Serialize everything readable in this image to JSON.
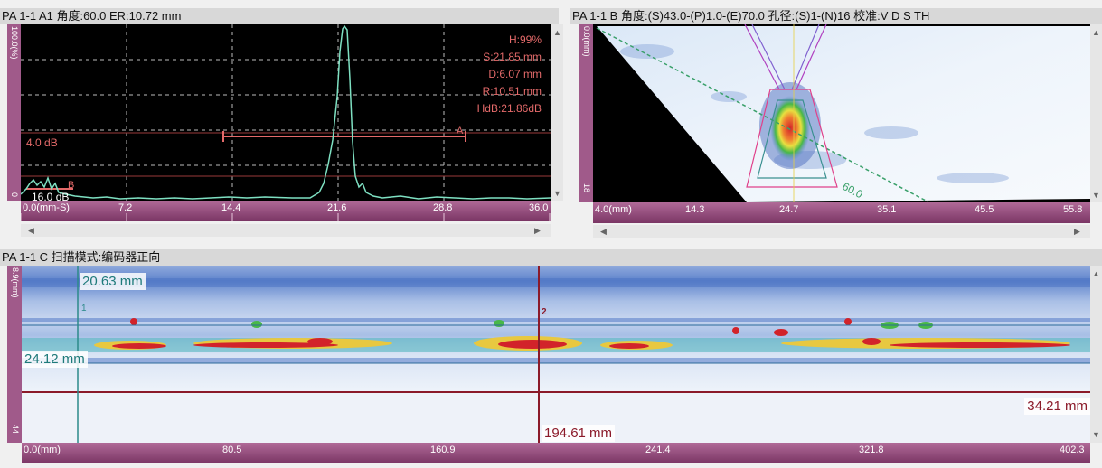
{
  "ascan": {
    "title": "PA 1-1 A1 角度:60.0 ER:10.72 mm",
    "vscale_label": "100.0(%)",
    "vscale_bottom": "0",
    "gate_label": "4.0 dB",
    "gate_marker": "A",
    "ref_label": "16.0 dB",
    "ref_marker": "B",
    "readouts": [
      "H:99%",
      "S:21.85 mm",
      "D:6.07 mm",
      "R:10.51 mm",
      "HdB:21.86dB"
    ],
    "axis_ticks": [
      "0.0(mm-S)",
      "7.2",
      "14.4",
      "21.6",
      "28.8",
      "36.0"
    ],
    "trace_color": "#7ee0c2",
    "gate_color": "#e46a6a"
  },
  "bscan": {
    "title": "PA 1-1 B 角度:(S)43.0-(P)1.0-(E)70.0 孔径:(S)1-(N)16 校准:V D S TH",
    "vscale_label": "0.0(mm)",
    "vscale_bottom": "18",
    "angle_label": "60.0",
    "axis_ticks": [
      "4.0(mm)",
      "14.3",
      "24.7",
      "35.1",
      "45.5",
      "55.8"
    ]
  },
  "cscan": {
    "title": "PA 1-1 C 扫描模式:编码器正向",
    "vscale_label": "8.9(mm)",
    "vscale_bottom": "44",
    "meas_top": "20.63 mm",
    "meas_mid": "24.12 mm",
    "meas_right": "34.21 mm",
    "meas_cursor": "194.61 mm",
    "cursor1_label": "1",
    "cursor2_label": "2",
    "axis_ticks": [
      "0.0(mm)",
      "80.5",
      "160.9",
      "241.4",
      "321.8",
      "402.3"
    ]
  }
}
